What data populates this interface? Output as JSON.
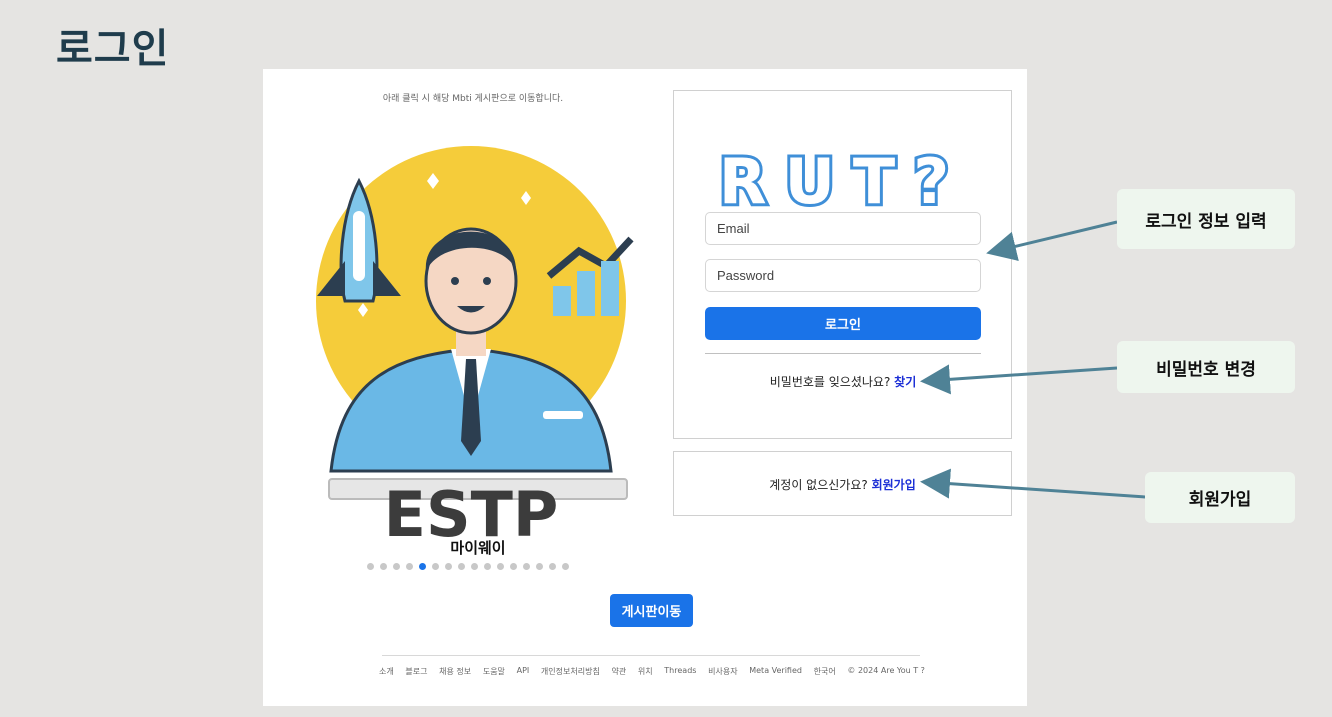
{
  "page_title": "로그인",
  "left_panel": {
    "hint": "아래 클릭 시 해당 Mbti 게시판으로 이동합니다.",
    "mbti_type": "ESTP",
    "mbti_name": "마이웨이",
    "carousel": {
      "total": 16,
      "active_index": 4
    },
    "board_button": "게시판이동"
  },
  "login": {
    "logo_text": "RUT?",
    "email_placeholder": "Email",
    "password_placeholder": "Password",
    "login_button": "로그인",
    "forgot_text": "비밀번호를 잊으셨나요?",
    "forgot_link": "찾기"
  },
  "signup": {
    "text": "계정이 없으신가요?",
    "link": "회원가입"
  },
  "footer": [
    "소개",
    "블로그",
    "채용 정보",
    "도움말",
    "API",
    "개인정보처리방침",
    "약관",
    "위치",
    "Threads",
    "비사용자",
    "Meta Verified",
    "한국어",
    "© 2024 Are You T ?"
  ],
  "annotations": {
    "login_info": "로그인 정보 입력",
    "password_change": "비밀번호 변경",
    "signup": "회원가입"
  },
  "colors": {
    "accent": "#1a73e8",
    "link": "#1c2fd6",
    "arrow": "#4f8296",
    "title": "#1f3c4c"
  }
}
